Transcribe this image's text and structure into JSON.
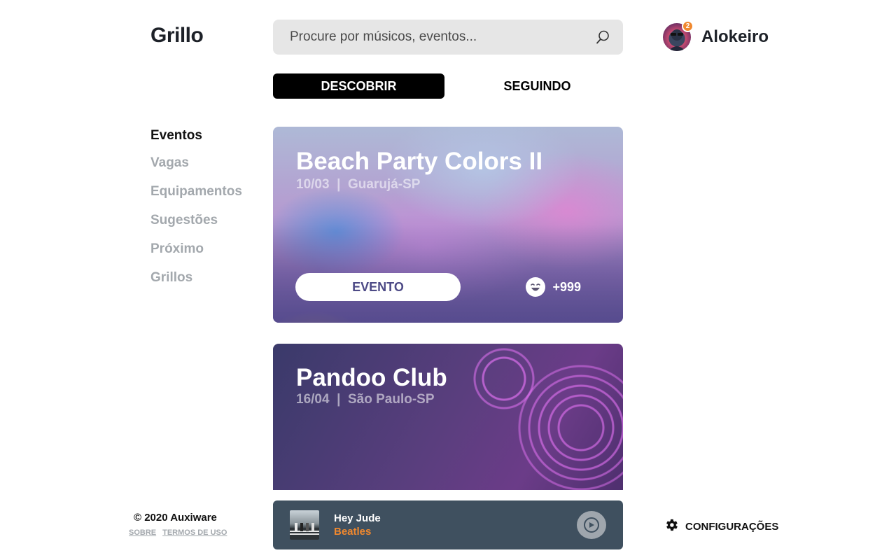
{
  "app": {
    "logo": "Grillo"
  },
  "search": {
    "placeholder": "Procure por músicos, eventos..."
  },
  "user": {
    "name": "Alokeiro",
    "notification_count": "2"
  },
  "tabs": [
    {
      "label": "DESCOBRIR",
      "active": true
    },
    {
      "label": "SEGUINDO",
      "active": false
    }
  ],
  "sidebar": {
    "items": [
      {
        "label": "Eventos",
        "active": true
      },
      {
        "label": "Vagas",
        "active": false
      },
      {
        "label": "Equipamentos",
        "active": false
      },
      {
        "label": "Sugestões",
        "active": false
      },
      {
        "label": "Próximo",
        "active": false
      },
      {
        "label": "Grillos",
        "active": false
      }
    ]
  },
  "feed": [
    {
      "title": "Beach Party Colors II",
      "subtitle": "10/03  |  Guarujá-SP",
      "category": "EVENTO",
      "reactions": "+999"
    },
    {
      "title": "Pandoo Club",
      "subtitle": "16/04  |  São Paulo-SP"
    }
  ],
  "footer": {
    "copyright": "© 2020 Auxiware",
    "links": [
      "SOBRE",
      "TERMOS DE USO"
    ]
  },
  "player": {
    "track": "Hey Jude",
    "artist": "Beatles"
  },
  "settings": {
    "label": "CONFIGURAÇÕES"
  },
  "colors": {
    "accent": "#f0882e",
    "player_bg": "#3f505f",
    "pill_text": "#4d4a86",
    "muted": "#a3a8ad"
  },
  "icons": [
    "search-icon",
    "avatar",
    "laughing-emoji-icon",
    "play-icon",
    "gear-icon"
  ]
}
